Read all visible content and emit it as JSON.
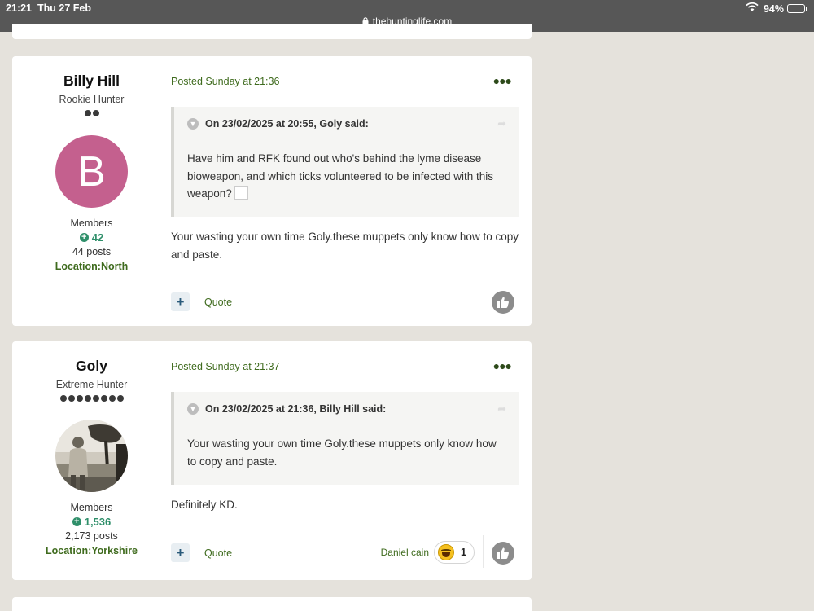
{
  "status_bar": {
    "time": "21:21",
    "date": "Thu 27 Feb",
    "url": "thehuntinglife.com",
    "battery": "94%",
    "battery_level": 0.94
  },
  "posts": [
    {
      "author": {
        "name": "Billy Hill",
        "rank": "Rookie Hunter",
        "rank_pips": 2,
        "avatar_letter": "B",
        "avatar_color": "#c4608e",
        "group": "Members",
        "reputation": "42",
        "post_count": "44 posts",
        "location": "Location:North"
      },
      "posted": "Posted Sunday at 21:36",
      "more_icon": "ellipsis-icon",
      "quote": {
        "header": "On 23/02/2025 at 20:55, Goly said:",
        "text": "Have him and RFK found out who's behind the lyme disease bioweapon, and which ticks volunteered to be infected with this weapon?"
      },
      "body": "Your wasting your own time Goly.these muppets only know how to copy and paste.",
      "footer": {
        "add_label": "+",
        "quote_label": "Quote"
      }
    },
    {
      "author": {
        "name": "Goly",
        "rank": "Extreme Hunter",
        "rank_pips": 8,
        "avatar_image": "black-and-white-photo-of-man",
        "group": "Members",
        "reputation": "1,536",
        "post_count": "2,173 posts",
        "location": "Location:Yorkshire"
      },
      "posted": "Posted Sunday at 21:37",
      "more_icon": "ellipsis-icon",
      "quote": {
        "header": "On 23/02/2025 at 21:36, Billy Hill said:",
        "text": "Your wasting your own time Goly.these muppets only know how to copy and paste."
      },
      "body": "Definitely KD.",
      "footer": {
        "add_label": "+",
        "quote_label": "Quote",
        "reactors": "Daniel cain",
        "reaction_icon": "laughing-emoji-icon",
        "reaction_count": "1"
      }
    }
  ],
  "colors": {
    "page_bg": "#e5e2dc",
    "status_bar": "#575757",
    "link_green": "#3f6b1e",
    "reputation_green": "#2f8f6a"
  }
}
